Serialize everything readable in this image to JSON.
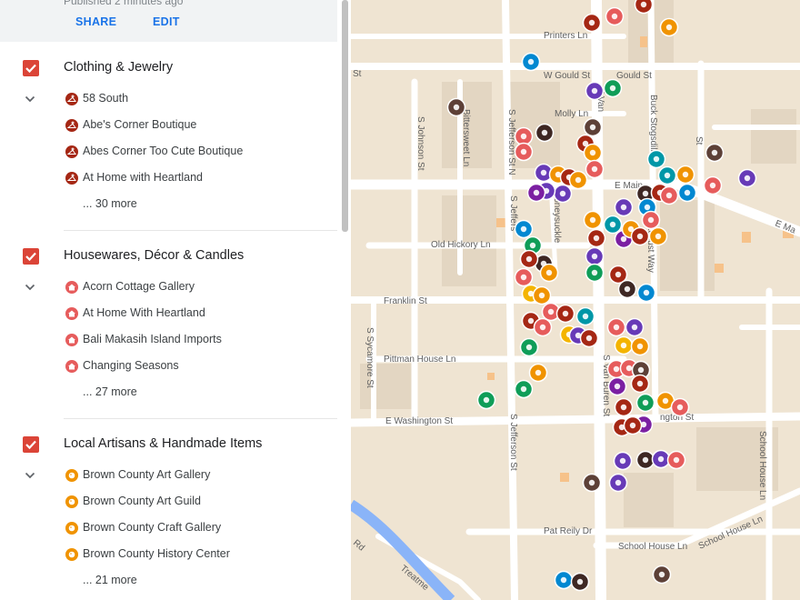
{
  "panel": {
    "published": "Published 2 minutes ago",
    "share_label": "SHARE",
    "edit_label": "EDIT"
  },
  "sections": [
    {
      "title": "Clothing & Jewelry",
      "icon": "hanger-icon",
      "color": "#a52714",
      "items": [
        "58 South",
        "Abe's Corner Boutique",
        "Abes Corner Too Cute Boutique",
        "At Home with Heartland"
      ],
      "more": "... 30 more"
    },
    {
      "title": "Housewares, Décor & Candles",
      "icon": "home-icon",
      "color": "#e65c5c",
      "items": [
        "Acorn Cottage Gallery",
        "At Home With Heartland",
        "Bali Makasih Island Imports",
        "Changing Seasons"
      ],
      "more": "... 27 more"
    },
    {
      "title": "Local Artisans & Handmade Items",
      "icon": "palette-icon",
      "color": "#f09300",
      "items": [
        "Brown County Art Gallery",
        "Brown County Art Guild",
        "Brown County Craft Gallery",
        "Brown County History Center"
      ],
      "more": "... 21 more"
    }
  ],
  "map": {
    "streets": {
      "printers": "Printers Ln",
      "w_gould": "W Gould St",
      "gould_st": "Gould St",
      "st_left": "St",
      "molly": "Molly Ln",
      "n_van": "N Van",
      "s_johnson": "S Johnson St",
      "bittersweet": "Bittersweet Ln",
      "s_jefferson_n": "S Jefferson St N",
      "buck_stogsdill": "Buck Stogsdill",
      "e_main": "E Main",
      "e_ma_right": "E Ma",
      "st_small": "St",
      "old_hickory": "Old Hickory Ln",
      "honeysuckle": "Honeysuckle",
      "s_jefferson_s": "S Jeffers",
      "locust_way": "Locust Way",
      "franklin": "Franklin St",
      "sycamore": "S Sycamore St",
      "pittman": "Pittman House Ln",
      "s_van_buren": "S Van Buren St",
      "e_washington": "E Washington St",
      "washington_right": "ngton St",
      "s_jefferson_lower": "S Jefferson St",
      "school_house_ln_v": "School House Ln",
      "pat_reily": "Pat Reily Dr",
      "school_house_ln": "School House Ln",
      "school_house_ln_2": "School House Ln",
      "rd": "Rd",
      "treatment": "Treatme"
    },
    "category_colors": {
      "clothing": "#a52714",
      "housewares": "#e65c5c",
      "artisans": "#f09300",
      "food": "#5d4037",
      "wine": "#3e2723",
      "services": "#7b1fa2",
      "gifts": "#673ab7",
      "books": "#0288d1",
      "outdoors": "#0f9d58",
      "teal": "#0097a7",
      "sweets": "#f4b400"
    }
  }
}
